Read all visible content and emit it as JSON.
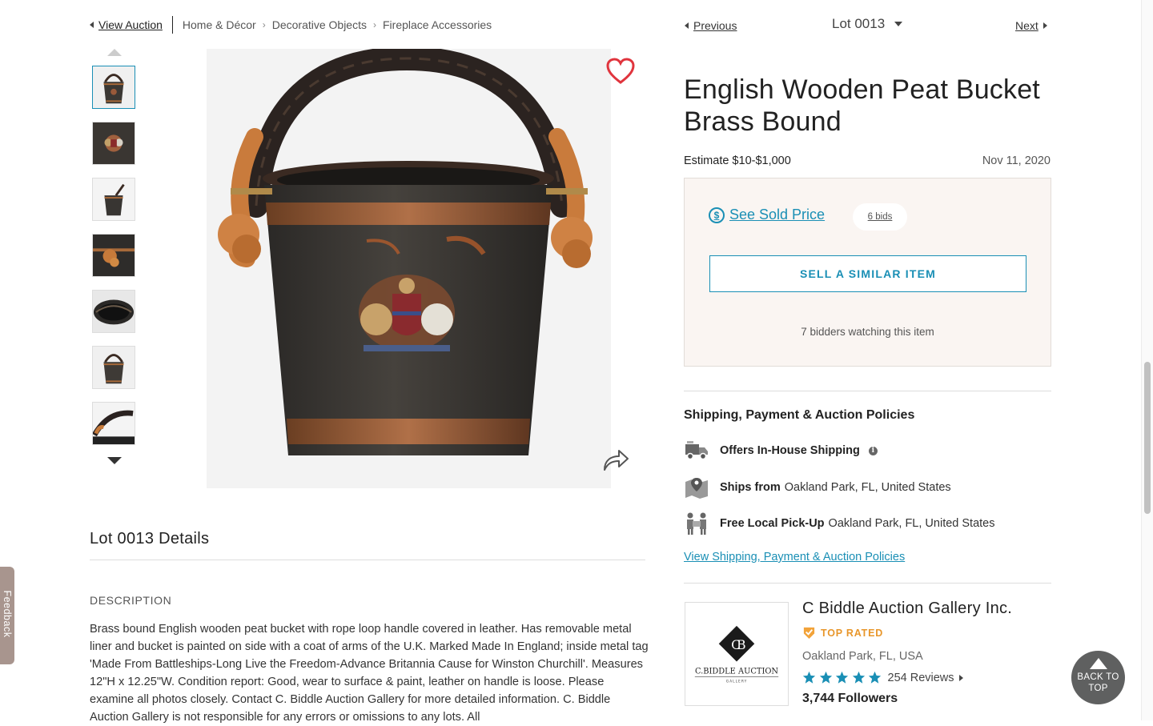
{
  "breadcrumb": {
    "view_auction": "View Auction",
    "items": [
      "Home & Décor",
      "Decorative Objects",
      "Fireplace Accessories"
    ]
  },
  "gallery": {
    "thumbnail_count": 7,
    "active_index": 0
  },
  "lot_nav": {
    "previous": "Previous",
    "next": "Next",
    "lot_label": "Lot 0013"
  },
  "item": {
    "title": "English Wooden Peat Bucket Brass Bound",
    "estimate": "Estimate $10-$1,000",
    "date": "Nov 11, 2020"
  },
  "bidding": {
    "see_sold_price": "See Sold Price",
    "bids": "6 bids",
    "sell_similar": "SELL A SIMILAR ITEM",
    "watching": "7 bidders watching this item"
  },
  "shipping": {
    "heading": "Shipping, Payment & Auction Policies",
    "in_house": "Offers In-House Shipping",
    "ships_from_label": "Ships from",
    "ships_from_value": "Oakland Park, FL, United States",
    "pickup_label": "Free Local Pick-Up",
    "pickup_value": "Oakland Park, FL, United States",
    "policies_link": "View Shipping, Payment & Auction Policies"
  },
  "seller": {
    "name": "C Biddle Auction Gallery Inc.",
    "badge": "TOP RATED",
    "location": "Oakland Park, FL, USA",
    "rating": 5,
    "reviews": "254 Reviews",
    "followers": "3,744 Followers",
    "logo_line1": "C.BIDDLE AUCTION",
    "logo_line2": "GALLERY"
  },
  "details": {
    "title": "Lot 0013 Details",
    "description_label": "DESCRIPTION",
    "description": "Brass bound English wooden peat bucket with rope loop handle covered in leather. Has removable metal liner and bucket is painted on side with a coat of arms of the U.K. Marked Made In England; inside metal tag 'Made From Battleships-Long Live the Freedom-Advance Britannia Cause for Winston Churchill'. Measures 12\"H x 12.25\"W. Condition report: Good, wear to surface & paint, leather on handle is loose. Please examine all photos closely. Contact C. Biddle Auction Gallery for more detailed information. C. Biddle Auction Gallery is not responsible for any errors or omissions to any lots. All"
  },
  "ui": {
    "feedback": "Feedback",
    "back_to_top": "BACK TO TOP"
  },
  "colors": {
    "accent": "#1a8fb5",
    "badge": "#e8962a",
    "heart": "#e0343d",
    "bid_box_bg": "#faf5f2"
  }
}
